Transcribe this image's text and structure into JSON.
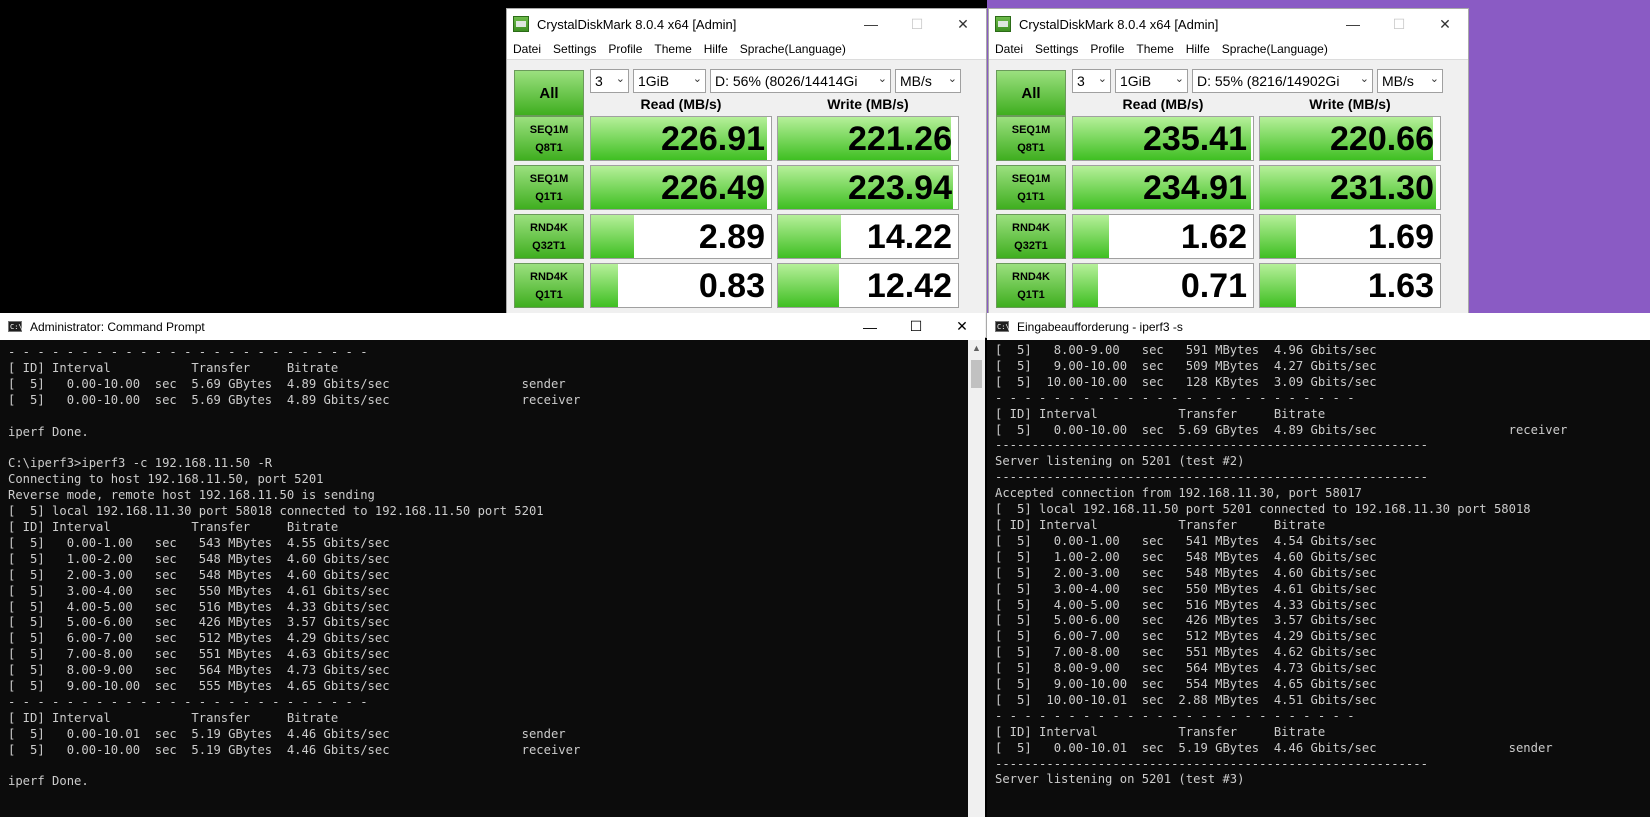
{
  "cdm_left": {
    "title": "CrystalDiskMark 8.0.4 x64 [Admin]",
    "menu": [
      "Datei",
      "Settings",
      "Profile",
      "Theme",
      "Hilfe",
      "Sprache(Language)"
    ],
    "all_label": "All",
    "count": "3",
    "size": "1GiB",
    "drive": "D: 56% (8026/14414Gi",
    "unit": "MB/s",
    "read_header": "Read (MB/s)",
    "write_header": "Write (MB/s)",
    "rows": [
      {
        "l1": "SEQ1M",
        "l2": "Q8T1",
        "read": "226.91",
        "write": "221.26",
        "read_fill": 0.98,
        "write_fill": 0.96
      },
      {
        "l1": "SEQ1M",
        "l2": "Q1T1",
        "read": "226.49",
        "write": "223.94",
        "read_fill": 0.98,
        "write_fill": 0.97
      },
      {
        "l1": "RND4K",
        "l2": "Q32T1",
        "read": "2.89",
        "write": "14.22",
        "read_fill": 0.24,
        "write_fill": 0.35
      },
      {
        "l1": "RND4K",
        "l2": "Q1T1",
        "read": "0.83",
        "write": "12.42",
        "read_fill": 0.15,
        "write_fill": 0.34
      }
    ]
  },
  "cdm_right": {
    "title": "CrystalDiskMark 8.0.4 x64 [Admin]",
    "menu": [
      "Datei",
      "Settings",
      "Profile",
      "Theme",
      "Hilfe",
      "Sprache(Language)"
    ],
    "all_label": "All",
    "count": "3",
    "size": "1GiB",
    "drive": "D: 55% (8216/14902Gi",
    "unit": "MB/s",
    "read_header": "Read (MB/s)",
    "write_header": "Write (MB/s)",
    "rows": [
      {
        "l1": "SEQ1M",
        "l2": "Q8T1",
        "read": "235.41",
        "write": "220.66",
        "read_fill": 0.99,
        "write_fill": 0.96
      },
      {
        "l1": "SEQ1M",
        "l2": "Q1T1",
        "read": "234.91",
        "write": "231.30",
        "read_fill": 0.99,
        "write_fill": 0.98
      },
      {
        "l1": "RND4K",
        "l2": "Q32T1",
        "read": "1.62",
        "write": "1.69",
        "read_fill": 0.2,
        "write_fill": 0.2
      },
      {
        "l1": "RND4K",
        "l2": "Q1T1",
        "read": "0.71",
        "write": "1.63",
        "read_fill": 0.14,
        "write_fill": 0.2
      }
    ]
  },
  "cmd_left": {
    "title": "Administrator: Command Prompt",
    "lines": [
      "- - - - - - - - - - - - - - - - - - - - - - - - -",
      "[ ID] Interval           Transfer     Bitrate",
      "[  5]   0.00-10.00  sec  5.69 GBytes  4.89 Gbits/sec                  sender",
      "[  5]   0.00-10.00  sec  5.69 GBytes  4.89 Gbits/sec                  receiver",
      "",
      "iperf Done.",
      "",
      "C:\\iperf3>iperf3 -c 192.168.11.50 -R",
      "Connecting to host 192.168.11.50, port 5201",
      "Reverse mode, remote host 192.168.11.50 is sending",
      "[  5] local 192.168.11.30 port 58018 connected to 192.168.11.50 port 5201",
      "[ ID] Interval           Transfer     Bitrate",
      "[  5]   0.00-1.00   sec   543 MBytes  4.55 Gbits/sec",
      "[  5]   1.00-2.00   sec   548 MBytes  4.60 Gbits/sec",
      "[  5]   2.00-3.00   sec   548 MBytes  4.60 Gbits/sec",
      "[  5]   3.00-4.00   sec   550 MBytes  4.61 Gbits/sec",
      "[  5]   4.00-5.00   sec   516 MBytes  4.33 Gbits/sec",
      "[  5]   5.00-6.00   sec   426 MBytes  3.57 Gbits/sec",
      "[  5]   6.00-7.00   sec   512 MBytes  4.29 Gbits/sec",
      "[  5]   7.00-8.00   sec   551 MBytes  4.63 Gbits/sec",
      "[  5]   8.00-9.00   sec   564 MBytes  4.73 Gbits/sec",
      "[  5]   9.00-10.00  sec   555 MBytes  4.65 Gbits/sec",
      "- - - - - - - - - - - - - - - - - - - - - - - - -",
      "[ ID] Interval           Transfer     Bitrate",
      "[  5]   0.00-10.01  sec  5.19 GBytes  4.46 Gbits/sec                  sender",
      "[  5]   0.00-10.00  sec  5.19 GBytes  4.46 Gbits/sec                  receiver",
      "",
      "iperf Done."
    ]
  },
  "cmd_right": {
    "title": "Eingabeaufforderung - iperf3  -s",
    "lines": [
      "[  5]   8.00-9.00   sec   591 MBytes  4.96 Gbits/sec",
      "[  5]   9.00-10.00  sec   509 MBytes  4.27 Gbits/sec",
      "[  5]  10.00-10.00  sec   128 KBytes  3.09 Gbits/sec",
      "- - - - - - - - - - - - - - - - - - - - - - - - -",
      "[ ID] Interval           Transfer     Bitrate",
      "[  5]   0.00-10.00  sec  5.69 GBytes  4.89 Gbits/sec                  receiver",
      "-----------------------------------------------------------",
      "Server listening on 5201 (test #2)",
      "-----------------------------------------------------------",
      "Accepted connection from 192.168.11.30, port 58017",
      "[  5] local 192.168.11.50 port 5201 connected to 192.168.11.30 port 58018",
      "[ ID] Interval           Transfer     Bitrate",
      "[  5]   0.00-1.00   sec   541 MBytes  4.54 Gbits/sec",
      "[  5]   1.00-2.00   sec   548 MBytes  4.60 Gbits/sec",
      "[  5]   2.00-3.00   sec   548 MBytes  4.60 Gbits/sec",
      "[  5]   3.00-4.00   sec   550 MBytes  4.61 Gbits/sec",
      "[  5]   4.00-5.00   sec   516 MBytes  4.33 Gbits/sec",
      "[  5]   5.00-6.00   sec   426 MBytes  3.57 Gbits/sec",
      "[  5]   6.00-7.00   sec   512 MBytes  4.29 Gbits/sec",
      "[  5]   7.00-8.00   sec   551 MBytes  4.62 Gbits/sec",
      "[  5]   8.00-9.00   sec   564 MBytes  4.73 Gbits/sec",
      "[  5]   9.00-10.00  sec   554 MBytes  4.65 Gbits/sec",
      "[  5]  10.00-10.01  sec  2.88 MBytes  4.51 Gbits/sec",
      "- - - - - - - - - - - - - - - - - - - - - - - - -",
      "[ ID] Interval           Transfer     Bitrate",
      "[  5]   0.00-10.01  sec  5.19 GBytes  4.46 Gbits/sec                  sender",
      "-----------------------------------------------------------",
      "Server listening on 5201 (test #3)"
    ]
  },
  "window_buttons": {
    "minimize": "—",
    "maximize": "☐",
    "close": "✕"
  },
  "colors": {
    "green_bar": "#3fbf22",
    "bg": "#0c0c0c",
    "desktop_purple": "#8a5bc4"
  }
}
